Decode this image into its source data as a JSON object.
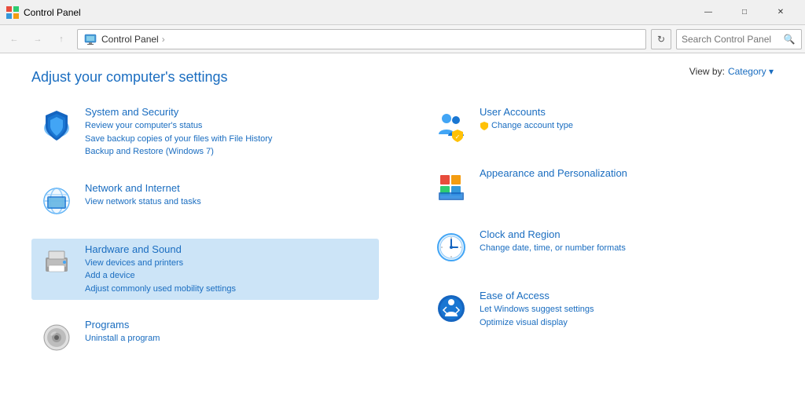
{
  "titleBar": {
    "title": "Control Panel",
    "icon": "control-panel",
    "minimize": "—",
    "maximize": "□",
    "close": "✕"
  },
  "addressBar": {
    "back": "←",
    "forward": "→",
    "up": "↑",
    "addressIcon": "📁",
    "path": "Control Panel",
    "separator": "›",
    "refresh": "↻",
    "searchPlaceholder": "Search Control Panel"
  },
  "viewBy": {
    "label": "View by:",
    "value": "Category ▾"
  },
  "pageTitle": "Adjust your computer's settings",
  "leftPanel": {
    "items": [
      {
        "id": "system-security",
        "title": "System and Security",
        "links": [
          "Review your computer's status",
          "Save backup copies of your files with File History",
          "Backup and Restore (Windows 7)"
        ],
        "highlighted": false
      },
      {
        "id": "network-internet",
        "title": "Network and Internet",
        "links": [
          "View network status and tasks"
        ],
        "highlighted": false
      },
      {
        "id": "hardware-sound",
        "title": "Hardware and Sound",
        "links": [
          "View devices and printers",
          "Add a device",
          "Adjust commonly used mobility settings"
        ],
        "highlighted": true
      },
      {
        "id": "programs",
        "title": "Programs",
        "links": [
          "Uninstall a program"
        ],
        "highlighted": false
      }
    ]
  },
  "rightPanel": {
    "items": [
      {
        "id": "user-accounts",
        "title": "User Accounts",
        "links": [
          "Change account type"
        ],
        "highlighted": false
      },
      {
        "id": "appearance",
        "title": "Appearance and Personalization",
        "links": [],
        "highlighted": false
      },
      {
        "id": "clock-region",
        "title": "Clock and Region",
        "links": [
          "Change date, time, or number formats"
        ],
        "highlighted": false
      },
      {
        "id": "ease-access",
        "title": "Ease of Access",
        "links": [
          "Let Windows suggest settings",
          "Optimize visual display"
        ],
        "highlighted": false
      }
    ]
  }
}
